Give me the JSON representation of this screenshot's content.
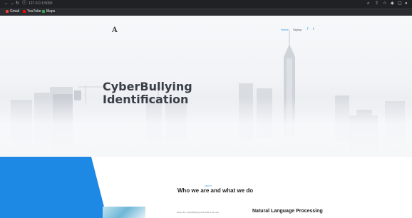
{
  "browser": {
    "url": "127.0.0.1:5000",
    "bookmarks": [
      {
        "label": "Gmail",
        "color": "#ea4335"
      },
      {
        "label": "YouTube",
        "color": "#ff0000"
      },
      {
        "label": "Maps",
        "color": "#34a853"
      }
    ]
  },
  "site": {
    "logo": "A",
    "nav": {
      "home": "Home",
      "signup": "Signup"
    },
    "social": {
      "facebook": "f",
      "twitter": "t"
    }
  },
  "hero": {
    "title_line1": "CyberBullying",
    "title_line2": "Identification"
  },
  "about": {
    "kicker": "ABOUT",
    "title": "Who we are and what we do",
    "text": "About the CyberBullying and what is the use",
    "nlp_title": "Natural Language Processing"
  },
  "colors": {
    "accent": "#2d9cdb",
    "blue_block": "#1e88e5"
  }
}
